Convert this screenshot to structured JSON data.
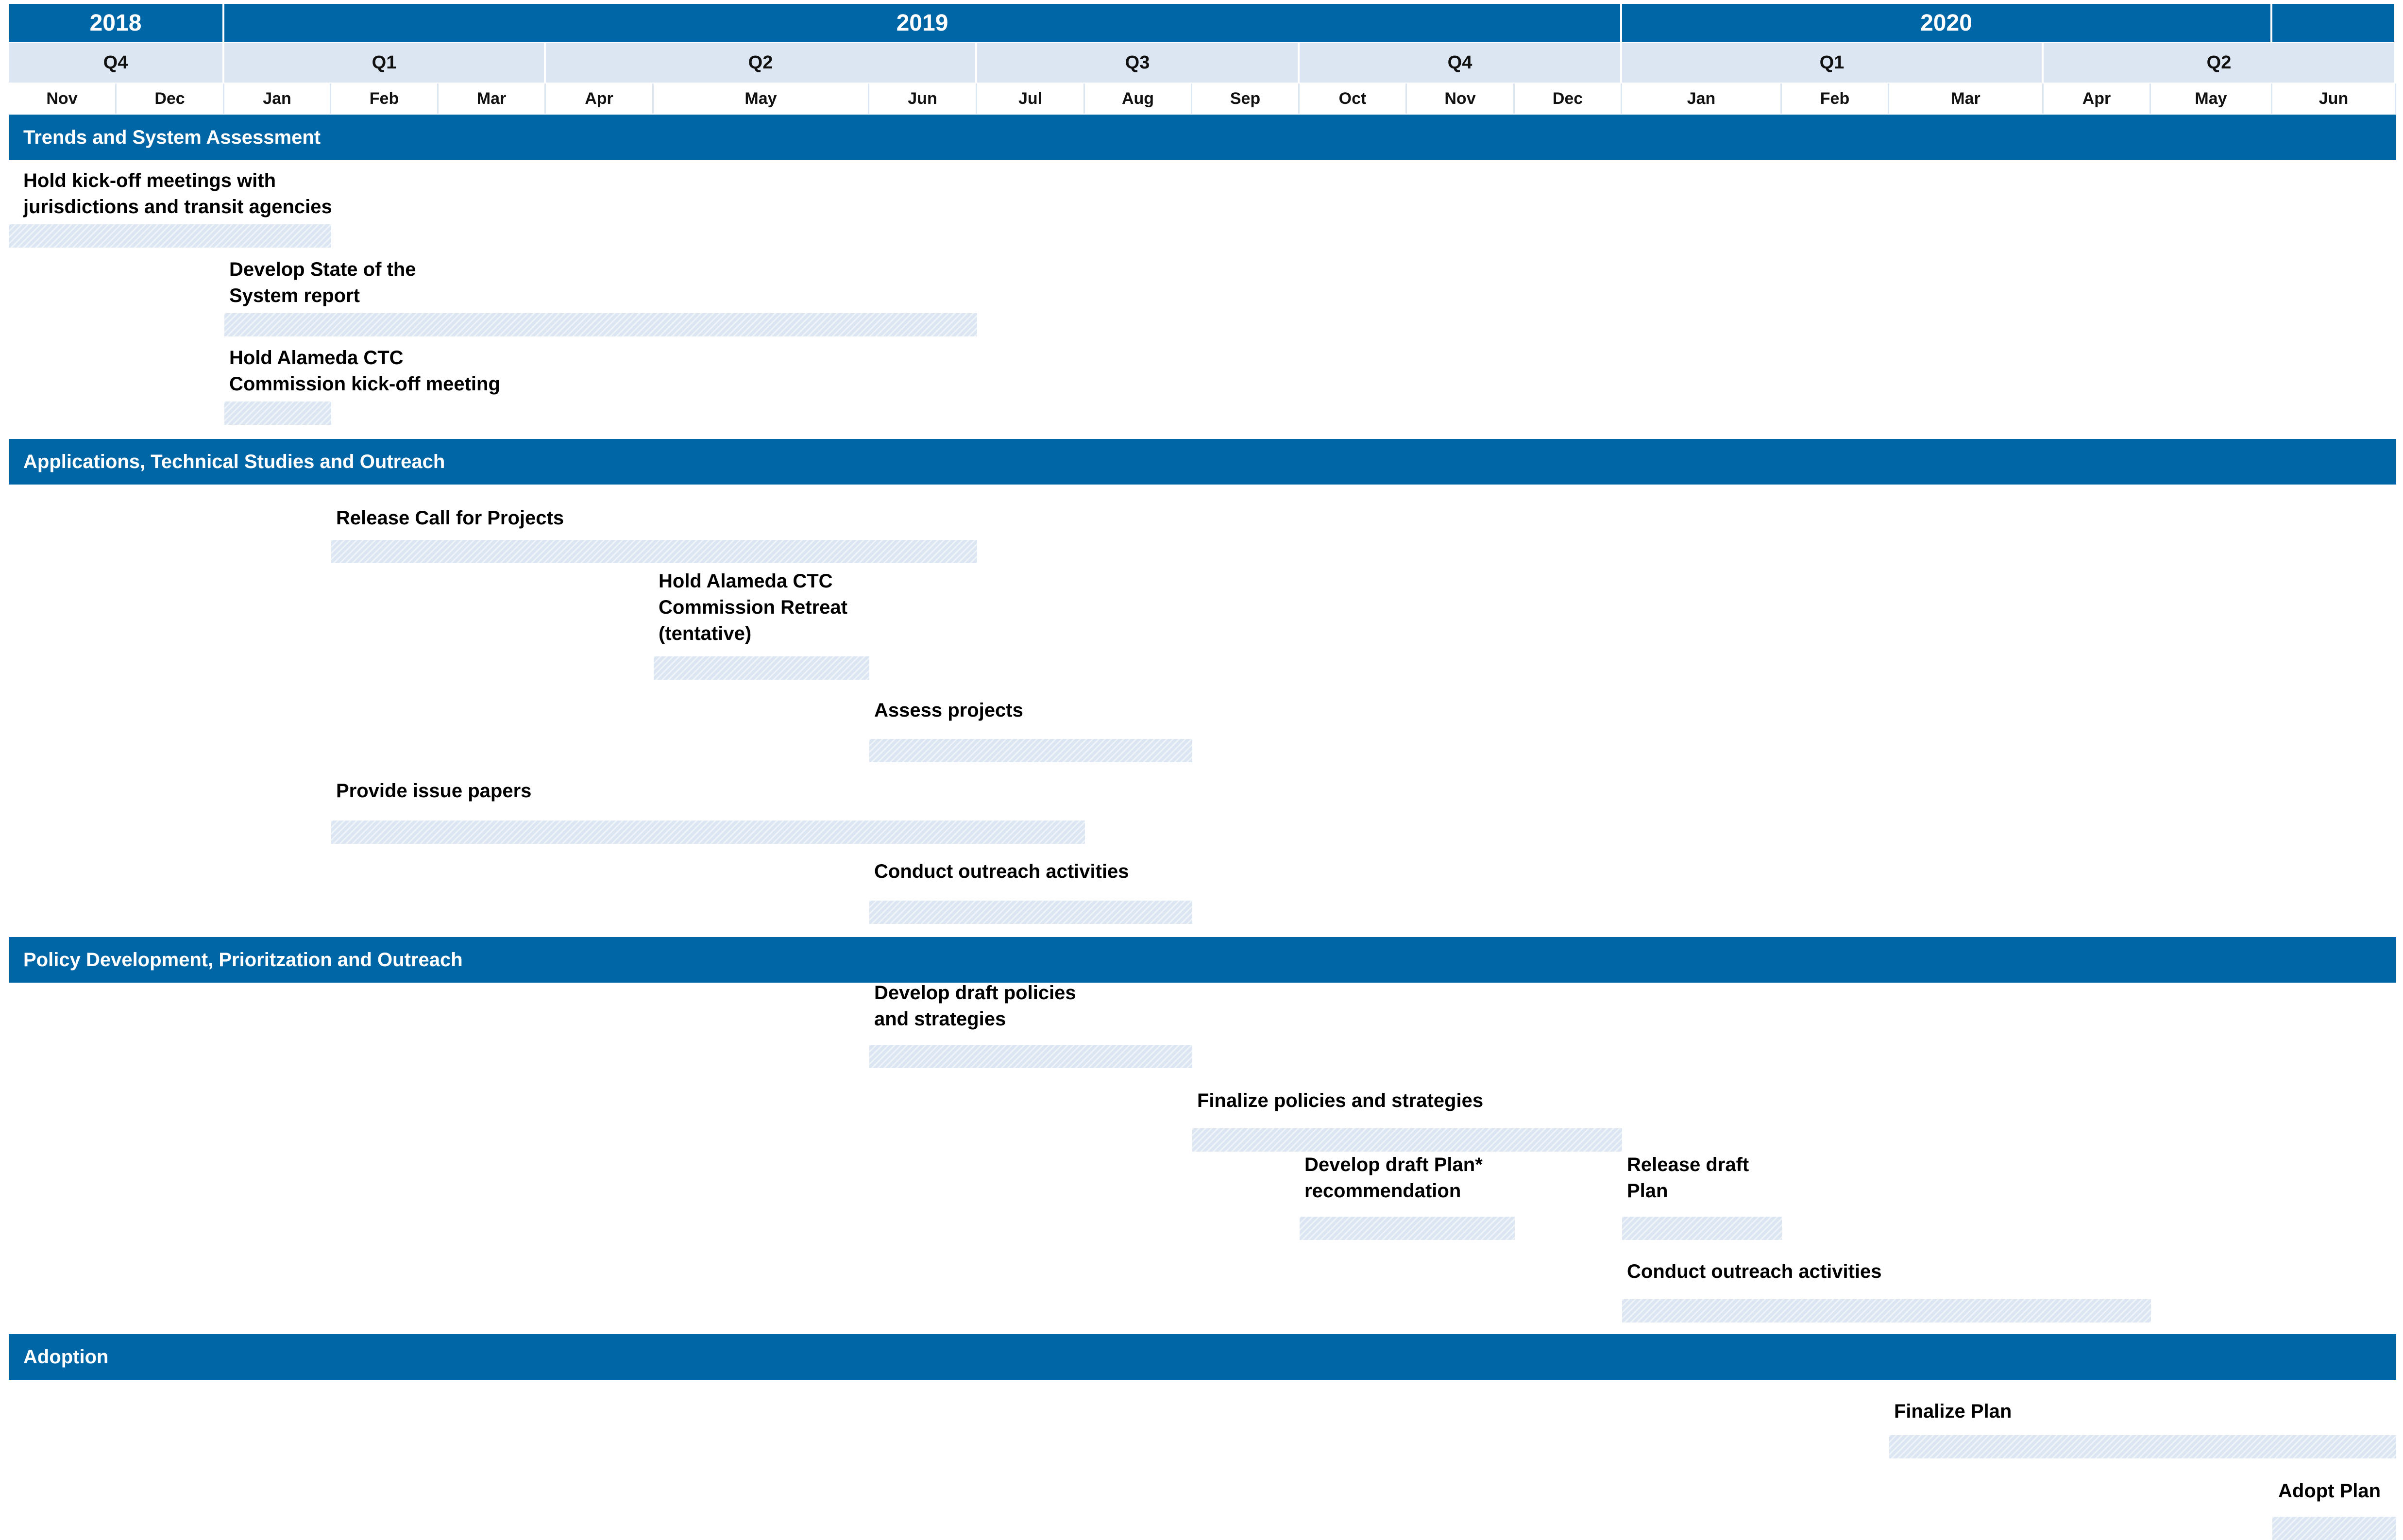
{
  "chart_data": {
    "type": "gantt",
    "years": [
      {
        "label": "2018",
        "start": "2018-11",
        "end": "2018-12"
      },
      {
        "label": "2019",
        "start": "2019-01",
        "end": "2019-12"
      },
      {
        "label": "2020",
        "start": "2020-01",
        "end": "2020-05"
      },
      {
        "label": "",
        "start": "2020-06",
        "end": "2020-06"
      }
    ],
    "quarters": [
      {
        "label": "Q4",
        "start": "2018-11",
        "end": "2018-12"
      },
      {
        "label": "Q1",
        "start": "2019-01",
        "end": "2019-03"
      },
      {
        "label": "Q2",
        "start": "2019-04",
        "end": "2019-06"
      },
      {
        "label": "Q3",
        "start": "2019-06",
        "end": "2019-08"
      },
      {
        "label": "Q4",
        "start": "2019-10",
        "end": "2019-12"
      },
      {
        "label": "Q1",
        "start": "2020-01",
        "end": "2020-03"
      },
      {
        "label": "Q2",
        "start": "2020-04",
        "end": "2020-06"
      }
    ],
    "months": [
      "Nov",
      "Dec",
      "Jan",
      "Feb",
      "Mar",
      "Apr",
      "May",
      "Jun",
      "Jul",
      "Aug",
      "Sep",
      "Oct",
      "Nov",
      "Dec",
      "Jan",
      "Feb",
      "Mar",
      "Apr",
      "May",
      "Jun"
    ],
    "sections": [
      {
        "title": "Trends and System Assessment",
        "tasks": [
          {
            "label": "Hold kick-off meetings with\njurisdictions and transit agencies",
            "start": "2018-11",
            "end": "2019-01"
          },
          {
            "label": "Develop State of the\nSystem report",
            "start": "2019-01",
            "end": "2019-06"
          },
          {
            "label": "Hold Alameda CTC\nCommission kick-off meeting",
            "start": "2019-01",
            "end": "2019-01"
          }
        ]
      },
      {
        "title": "Applications, Technical Studies and Outreach",
        "tasks": [
          {
            "label": "Release Call for Projects",
            "start": "2019-02",
            "end": "2019-06"
          },
          {
            "label": "Hold Alameda CTC\nCommission Retreat\n(tentative)",
            "start": "2019-05",
            "end": "2019-05"
          },
          {
            "label": "Assess projects",
            "start": "2019-06",
            "end": "2019-08"
          },
          {
            "label": "Provide issue papers",
            "start": "2019-02",
            "end": "2019-08"
          },
          {
            "label": "Conduct outreach activities",
            "start": "2019-06",
            "end": "2019-08"
          }
        ]
      },
      {
        "title": "Policy Development, Prioritzation and Outreach",
        "tasks": [
          {
            "label": "Develop draft policies\nand strategies",
            "start": "2019-06",
            "end": "2019-08"
          },
          {
            "label": "Finalize policies and strategies",
            "start": "2019-09",
            "end": "2019-12"
          },
          {
            "label": "Develop draft Plan*\nrecommendation",
            "start": "2019-10",
            "end": "2019-11"
          },
          {
            "label": "Release draft\nPlan",
            "start": "2020-01",
            "end": "2020-01"
          },
          {
            "label": "Conduct outreach activities",
            "start": "2020-01",
            "end": "2020-04"
          }
        ]
      },
      {
        "title": "Adoption",
        "tasks": [
          {
            "label": "Finalize Plan",
            "start": "2020-03",
            "end": "2020-06"
          },
          {
            "label": "Adopt Plan",
            "start": "2020-06",
            "end": "2020-06"
          }
        ]
      }
    ],
    "colors": {
      "header": "#0066A6",
      "quarter_band": "#DCE6F2",
      "bar": "#DCE6F2",
      "header_text": "#FFFFFF",
      "text": "#000000"
    }
  }
}
